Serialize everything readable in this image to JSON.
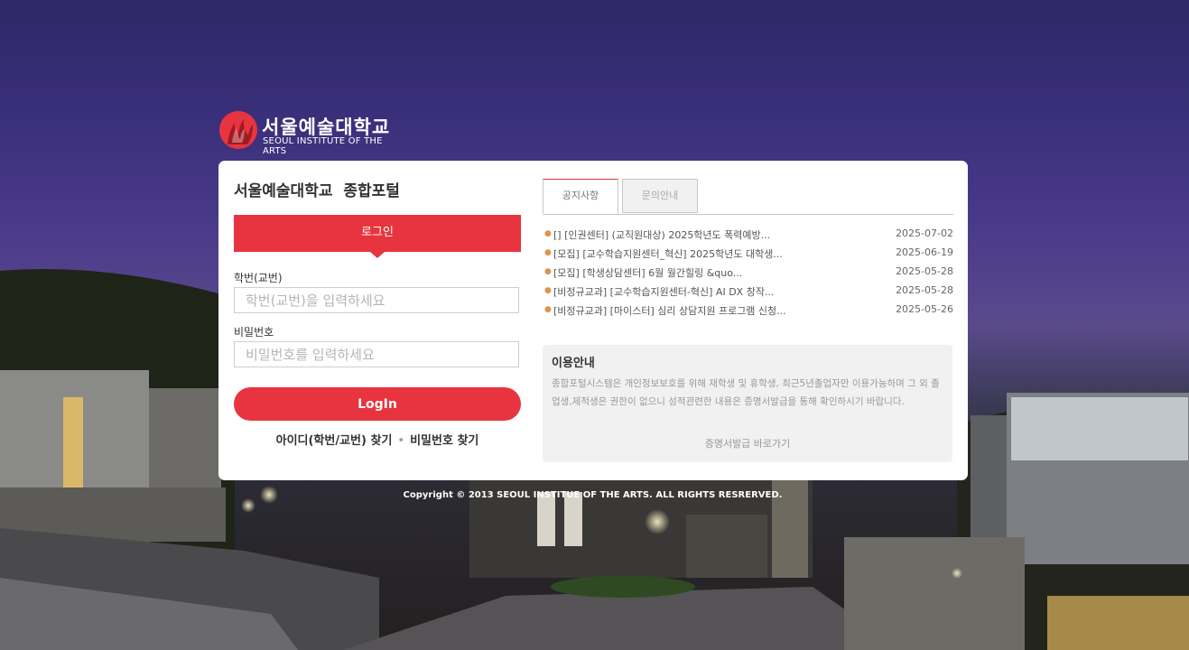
{
  "logo": {
    "title": "서울예술대학교",
    "subtitle": "SEOUL INSTITUTE OF THE ARTS",
    "brand_color": "#e8343f"
  },
  "portal_title": "서울예술대학교  종합포털",
  "login": {
    "tab_label": "로그인",
    "id_label": "학번(교번)",
    "id_placeholder": "학번(교번)을 입력하세요",
    "pw_label": "비밀번호",
    "pw_placeholder": "비밀번호를 입력하세요",
    "button_label": "LogIn",
    "find_id": "아이디(학번/교번) 찾기",
    "find_pw": "비밀번호 찾기"
  },
  "tabs": [
    {
      "label": "공지사항",
      "active": true
    },
    {
      "label": "문의안내",
      "active": false
    }
  ],
  "notices": [
    {
      "text": "[] [인권센터] (교직원대상) 2025학년도 폭력예방...",
      "date": "2025-07-02"
    },
    {
      "text": "[모집] [교수학습지원센터_혁신] 2025학년도 대학생...",
      "date": "2025-06-19"
    },
    {
      "text": "[모집] [학생상담센터] 6월 월간힐링 &quo...",
      "date": "2025-05-28"
    },
    {
      "text": "[비정규교과] [교수학습지원센터-혁신] AI DX 창작...",
      "date": "2025-05-28"
    },
    {
      "text": "[비정규교과] [마이스터] 심리 상담지원 프로그램 신청...",
      "date": "2025-05-26"
    }
  ],
  "info": {
    "title": "이용안내",
    "text": "종합포털시스템은 개인정보보호를 위해 재학생 및 휴학생, 최근5년졸업자만 이용가능하며 그 외 졸업생,제적생은 권한이 없으니 성적관련한 내용은 증명서발급을 통해 확인하시기 바랍니다.",
    "link": "증명서발급 바로가기"
  },
  "copyright": "Copyright © 2013 SEOUL INSTITUE OF THE ARTS. ALL RIGHTS RESRERVED.",
  "colors": {
    "accent": "#e8343f",
    "panel": "#ffffff",
    "info_bg": "#f1f1f1"
  }
}
